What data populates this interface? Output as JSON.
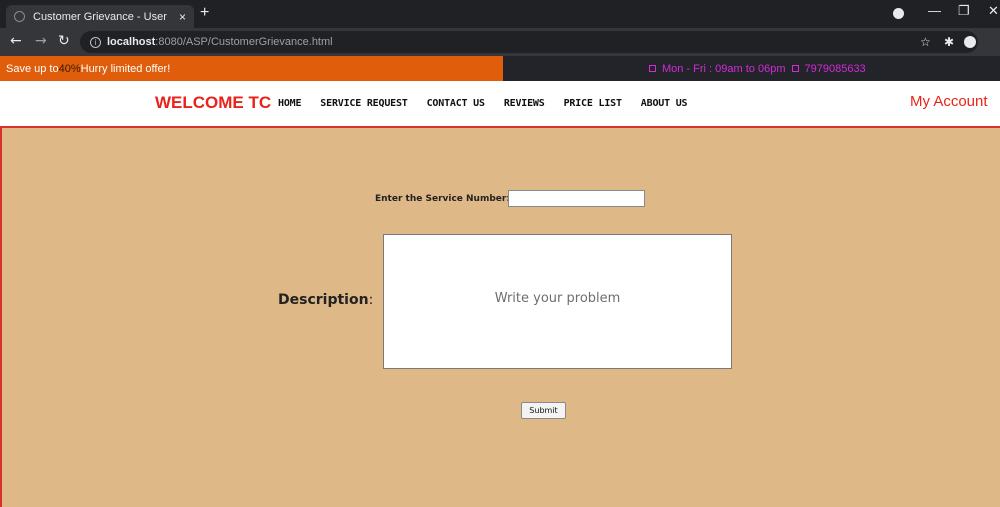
{
  "browser": {
    "tab_title": "Customer Grievance - User",
    "tab_close": "×",
    "new_tab": "+",
    "url_host": "localhost",
    "url_path": ":8080/ASP/CustomerGrievance.html",
    "window_min": "—",
    "window_restore": "❐",
    "window_close": "✕"
  },
  "promo": {
    "prefix": "Save up to ",
    "percent": "40%",
    "suffix": " Hurry limited offer!",
    "hours": "Mon - Fri : 09am to 06pm",
    "phone": "7979085633"
  },
  "nav": {
    "brand": "WELCOME TC",
    "links": [
      "HOME",
      "SERVICE REQUEST",
      "CONTACT US",
      "REVIEWS",
      "PRICE LIST",
      "ABOUT US"
    ],
    "account": "My Account"
  },
  "form": {
    "service_label": "Enter the Service Number:",
    "service_value": "",
    "description_label": "Description",
    "description_colon": ":",
    "description_placeholder": "Write your problem",
    "submit_label": "Submit"
  },
  "colors": {
    "promo_orange": "#e05d0b",
    "brand_red": "#e8231a",
    "main_bg": "#dfb888",
    "contact_magenta": "#d42ad8"
  }
}
